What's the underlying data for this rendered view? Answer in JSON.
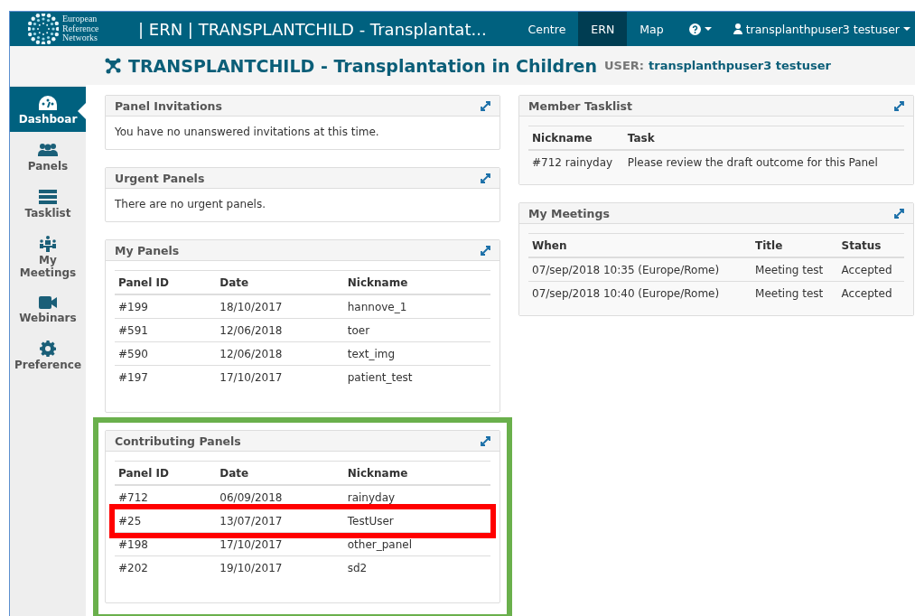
{
  "navbar": {
    "brand_lines": [
      "European",
      "Reference",
      "Networks"
    ],
    "app_title": "| ERN | TRANSPLANTCHILD - Transplantat...",
    "menu": [
      {
        "kind": "link",
        "label": "Centre",
        "selected": false
      },
      {
        "kind": "link",
        "label": "ERN",
        "selected": true
      },
      {
        "kind": "link",
        "label": "Map",
        "selected": false
      },
      {
        "kind": "help",
        "selected": false
      },
      {
        "kind": "user",
        "label": "transplanthpuser3 testuser",
        "selected": false
      }
    ]
  },
  "page_title": {
    "title": "TRANSPLANTCHILD - Transplantation in Children",
    "user_label": "USER:",
    "user_name": "transplanthpuser3 testuser"
  },
  "sidebar": {
    "items": [
      {
        "label": "Dashboar",
        "selected": true
      },
      {
        "label": "Panels",
        "selected": false
      },
      {
        "label": "Tasklist",
        "selected": false
      },
      {
        "label": "My Meetings",
        "selected": false
      },
      {
        "label": "Webinars",
        "selected": false
      },
      {
        "label": "Preference",
        "selected": false
      }
    ]
  },
  "left_panels": [
    {
      "title": "Panel Invitations",
      "kind": "message",
      "highlighted": false,
      "message": "You have no unanswered invitations at this time."
    },
    {
      "title": "Urgent Panels",
      "kind": "message",
      "highlighted": false,
      "message": "There are no urgent panels."
    },
    {
      "title": "My Panels",
      "kind": "table",
      "highlighted": false,
      "columns": [
        "Panel ID",
        "Date",
        "Nickname"
      ],
      "rows": [
        {
          "cells": [
            "#199",
            "18/10/2017",
            "hannove_1"
          ],
          "highlighted": false
        },
        {
          "cells": [
            "#591",
            "12/06/2018",
            "toer"
          ],
          "highlighted": false
        },
        {
          "cells": [
            "#590",
            "12/06/2018",
            "text_img"
          ],
          "highlighted": false
        },
        {
          "cells": [
            "#197",
            "17/10/2017",
            "patient_test"
          ],
          "highlighted": false
        }
      ]
    },
    {
      "title": "Contributing Panels",
      "kind": "table",
      "highlighted": true,
      "columns": [
        "Panel ID",
        "Date",
        "Nickname"
      ],
      "rows": [
        {
          "cells": [
            "#712",
            "06/09/2018",
            "rainyday"
          ],
          "highlighted": false
        },
        {
          "cells": [
            "#25",
            "13/07/2017",
            "TestUser"
          ],
          "highlighted": true
        },
        {
          "cells": [
            "#198",
            "17/10/2017",
            "other_panel"
          ],
          "highlighted": false
        },
        {
          "cells": [
            "#202",
            "19/10/2017",
            "sd2"
          ],
          "highlighted": false
        }
      ]
    }
  ],
  "right_panels": [
    {
      "title": "Member Tasklist",
      "kind": "table",
      "highlighted": false,
      "columns": [
        "Nickname",
        "Task"
      ],
      "rows": [
        {
          "cells": [
            "#712 rainyday",
            "Please review the draft outcome for this Panel"
          ],
          "highlighted": false
        }
      ]
    },
    {
      "title": "My Meetings",
      "kind": "table",
      "highlighted": false,
      "columns": [
        "When",
        "Title",
        "Status"
      ],
      "rows": [
        {
          "cells": [
            "07/sep/2018 10:35 (Europe/Rome)",
            "Meeting test",
            "Accepted"
          ],
          "highlighted": false
        },
        {
          "cells": [
            "07/sep/2018 10:40 (Europe/Rome)",
            "Meeting test",
            "Accepted"
          ],
          "highlighted": false
        }
      ]
    }
  ]
}
